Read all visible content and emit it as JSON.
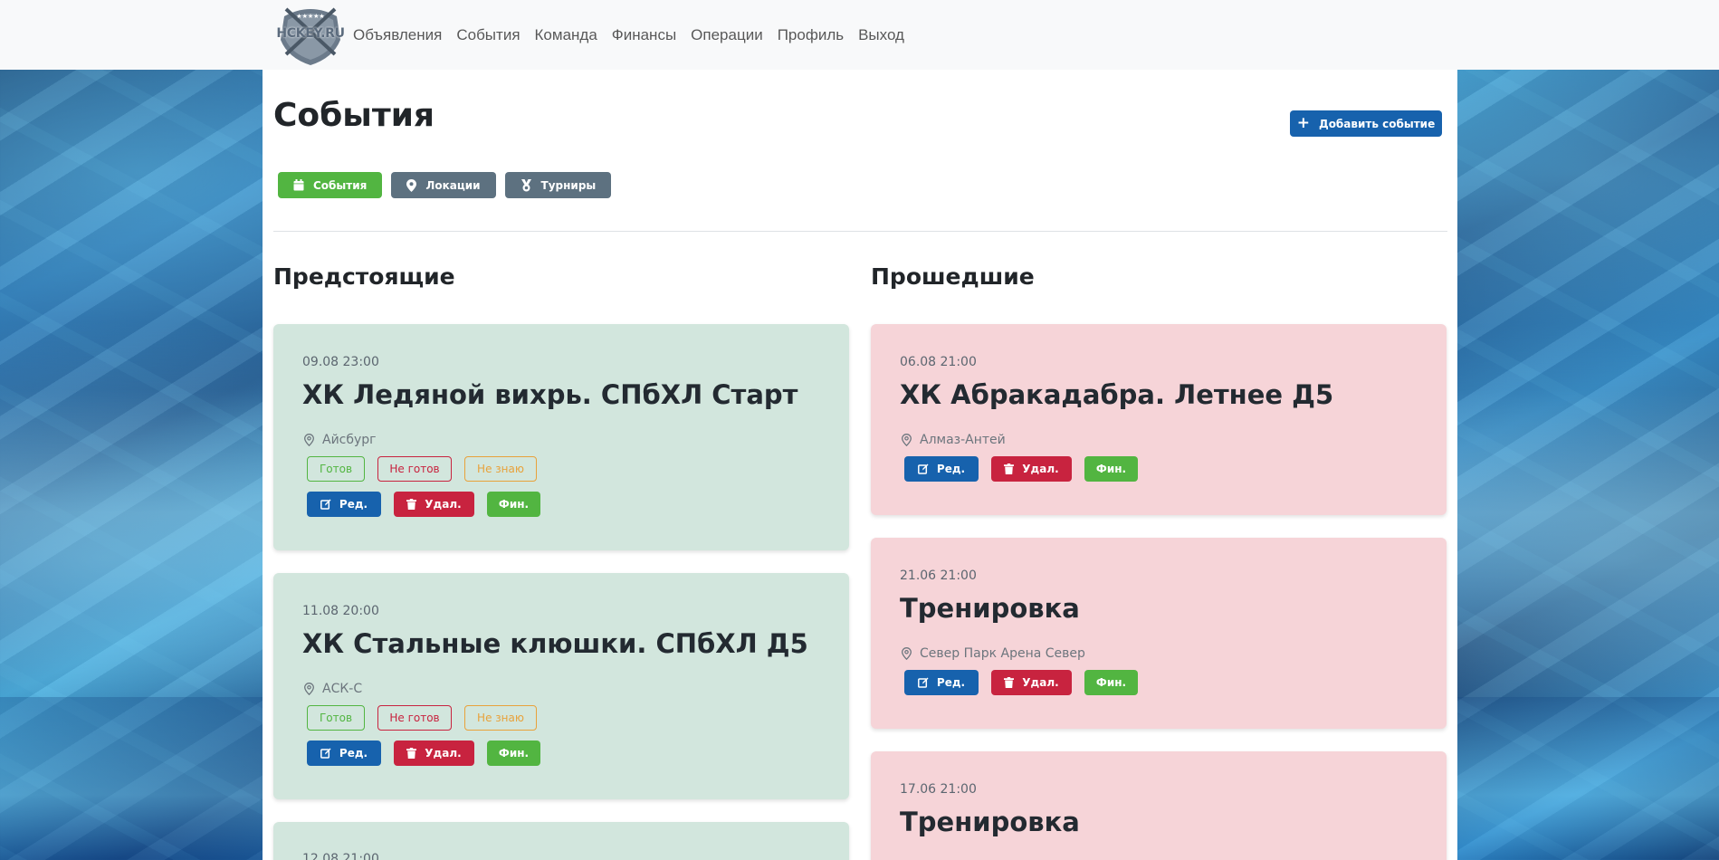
{
  "navbar": {
    "logo_text": "HCKEY.RU",
    "links": [
      "Объявления",
      "События",
      "Команда",
      "Финансы",
      "Операции",
      "Профиль",
      "Выход"
    ]
  },
  "page": {
    "title": "События",
    "add_button": "Добавить событие",
    "tabs": [
      {
        "label": "События",
        "icon": "calendar-icon",
        "active": true
      },
      {
        "label": "Локации",
        "icon": "map-pin-icon",
        "active": false
      },
      {
        "label": "Турниры",
        "icon": "medal-icon",
        "active": false
      }
    ]
  },
  "upcoming": {
    "title": "Предстоящие",
    "events": [
      {
        "date": "09.08 23:00",
        "title": "ХК Ледяной вихрь. СПбХЛ Старт",
        "location": "Айсбург"
      },
      {
        "date": "11.08 20:00",
        "title": "ХК Стальные клюшки. СПбХЛ Д5",
        "location": "АСК-С"
      },
      {
        "date": "12.08 21:00"
      }
    ],
    "status": {
      "ready": "Готов",
      "not_ready": "Не готов",
      "unknown": "Не знаю"
    }
  },
  "past": {
    "title": "Прошедшие",
    "events": [
      {
        "date": "06.08 21:00",
        "title": "ХК Абракадабра. Летнее Д5",
        "location": "Алмаз-Антей"
      },
      {
        "date": "21.06 21:00",
        "title": "Тренировка",
        "location": "Север Парк Арена Север"
      },
      {
        "date": "17.06 21:00",
        "title": "Тренировка"
      }
    ]
  },
  "actions": {
    "edit": "Ред.",
    "delete": "Удал.",
    "finance": "Фин."
  },
  "colors": {
    "primary": "#1762ad",
    "success": "#52b541",
    "danger": "#c8233f",
    "warning": "#e8a23b",
    "muted": "#5d7180",
    "upcoming_card": "#d2e6dd",
    "past_card": "#f6d4d8"
  }
}
